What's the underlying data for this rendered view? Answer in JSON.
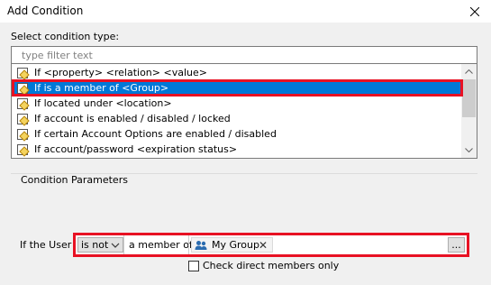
{
  "window": {
    "title": "Add Condition",
    "close_label": "×"
  },
  "condition_type": {
    "label": "Select condition type:",
    "filter_placeholder": "type filter text",
    "items": [
      {
        "label": "If <property> <relation> <value>",
        "selected": false
      },
      {
        "label": "If is a member of <Group>",
        "selected": true
      },
      {
        "label": "If located under <location>",
        "selected": false
      },
      {
        "label": "If account is enabled / disabled / locked",
        "selected": false
      },
      {
        "label": "If certain Account Options are enabled / disabled",
        "selected": false
      },
      {
        "label": "If account/password <expiration status>",
        "selected": false
      }
    ]
  },
  "parameters": {
    "group_label": "Condition Parameters",
    "row_label": "If the User",
    "operator_value": "is not",
    "relation_text": "a member of",
    "group_value": "My Group",
    "browse_label": "...",
    "checkbox_label": "Check direct members only",
    "checkbox_checked": false
  },
  "colors": {
    "highlight": "#e81123",
    "selection": "#0078d7"
  }
}
